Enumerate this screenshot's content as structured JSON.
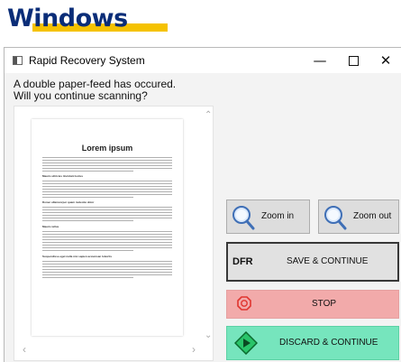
{
  "brand": {
    "logo_text": "Windows"
  },
  "window": {
    "title": "Rapid Recovery System",
    "minimize": "—",
    "close": "✕"
  },
  "message": {
    "line1": "A double paper-feed has occured.",
    "line2": "Will you continue scanning?"
  },
  "preview": {
    "page_title": "Lorem ipsum",
    "headings": [
      "Mauris ultricies tincidunt lectus",
      "Donec ullamcorper quam molestie dolor",
      "Mauris tellus",
      "Suspendisse eget nulla nisi sapien accumsan lobortis"
    ],
    "scroll_up": "⌃",
    "scroll_down": "⌄",
    "scroll_left": "‹",
    "scroll_right": "›"
  },
  "buttons": {
    "zoom_in": "Zoom in",
    "zoom_out": "Zoom out",
    "dfr": "DFR",
    "save_continue": "SAVE & CONTINUE",
    "stop": "STOP",
    "discard_continue": "DISCARD & CONTINUE"
  },
  "colors": {
    "stop_bg": "#f2aaaa",
    "discard_bg": "#76e5bd",
    "brand_blue": "#0a2d78",
    "brand_yellow": "#f5c200"
  },
  "icons": {
    "app": "app-window-icon",
    "zoom_in": "magnifier-icon",
    "zoom_out": "magnifier-icon",
    "stop": "stop-sign-icon",
    "discard": "diamond-arrow-icon"
  }
}
